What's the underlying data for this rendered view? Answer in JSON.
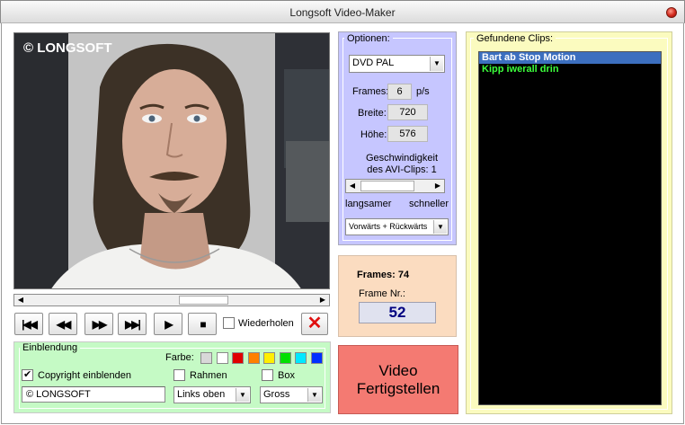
{
  "window": {
    "title": "Longsoft Video-Maker"
  },
  "video": {
    "watermark": "© LONGSOFT"
  },
  "transport": {
    "buttons": [
      "first",
      "rewind",
      "forward",
      "last",
      "play",
      "stop"
    ],
    "repeat_label": "Wiederholen",
    "repeat_checked": false
  },
  "einblendung": {
    "title": "Einblendung",
    "farbe_label": "Farbe:",
    "colors": [
      "#d8d8d8",
      "#ffffff",
      "#e00000",
      "#ff8000",
      "#ffee00",
      "#00e000",
      "#00e8ff",
      "#0030ff"
    ],
    "copyright_label": "Copyright einblenden",
    "copyright_checked": true,
    "rahmen_label": "Rahmen",
    "rahmen_checked": false,
    "box_label": "Box",
    "box_checked": false,
    "text_value": "© LONGSOFT",
    "position_value": "Links oben",
    "size_value": "Gross"
  },
  "optionen": {
    "title": "Optionen:",
    "format_value": "DVD PAL",
    "frames_label": "Frames:",
    "frames_value": "6",
    "frames_unit": "p/s",
    "breite_label": "Breite:",
    "breite_value": "720",
    "hoehe_label": "Höhe:",
    "hoehe_value": "576",
    "speed_line1": "Geschwindigkeit",
    "speed_line2": "des AVI-Clips: 1",
    "slower_label": "langsamer",
    "faster_label": "schneller",
    "direction_value": "Vorwärts + Rückwärts"
  },
  "framesinfo": {
    "frames_label": "Frames: 74",
    "frame_nr_label": "Frame Nr.:",
    "frame_nr_value": "52"
  },
  "video_button": {
    "line1": "Video",
    "line2": "Fertigstellen"
  },
  "clips": {
    "title": "Gefundene Clips:",
    "items": [
      {
        "label": "Bart ab Stop Motion",
        "selected": true
      },
      {
        "label": "Kipp iwerall drin",
        "selected": false
      }
    ]
  }
}
